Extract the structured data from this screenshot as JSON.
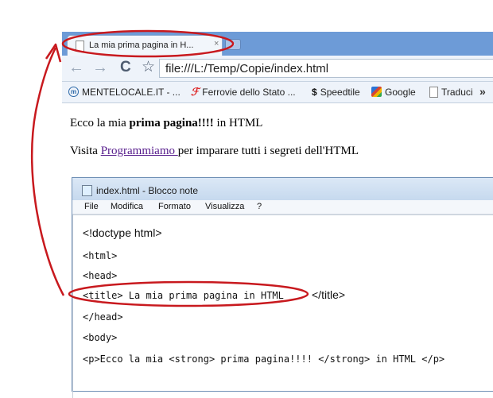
{
  "browser": {
    "tab": {
      "title": "La mia prima pagina in H...",
      "close": "×"
    },
    "new_tab": "+",
    "nav": {
      "back": "←",
      "forward": "→",
      "reload": "C",
      "star": "☆"
    },
    "address": "file:///L:/Temp/Copie/index.html",
    "bookmarks": [
      {
        "label": "MENTELOCALE.IT - ...",
        "icon": "mentelocale-icon"
      },
      {
        "label": "Ferrovie dello Stato ...",
        "icon": "ferrovie-icon"
      },
      {
        "label": "Speedtile",
        "icon": "speedtile-icon"
      },
      {
        "label": "Google",
        "icon": "google-icon"
      },
      {
        "label": "Traduci",
        "icon": "page-icon"
      }
    ],
    "bookmarks_more": "»"
  },
  "page": {
    "line1": {
      "before": "Ecco la mia ",
      "strong": "prima pagina!!!!",
      "after": " in HTML"
    },
    "line2": {
      "before": "Visita ",
      "link": "Programmiamo ",
      "after": "per imparare tutti i segreti dell'HTML"
    }
  },
  "notepad": {
    "title": "index.html - Blocco note",
    "menu": [
      "File",
      "Modifica",
      "Formato",
      "Visualizza",
      "?"
    ],
    "lines": {
      "doctype": " <!doctype html>",
      "html": "<html>",
      "head": "<head>",
      "title_open": "<title> La mia prima pagina in HTML",
      "title_close": "</title>",
      "head_close": "</head>",
      "body": "<body>",
      "p": "<p>Ecco la mia <strong> prima pagina!!!! </strong> in HTML </p>"
    }
  },
  "annotation": {
    "color": "#c8191e"
  }
}
